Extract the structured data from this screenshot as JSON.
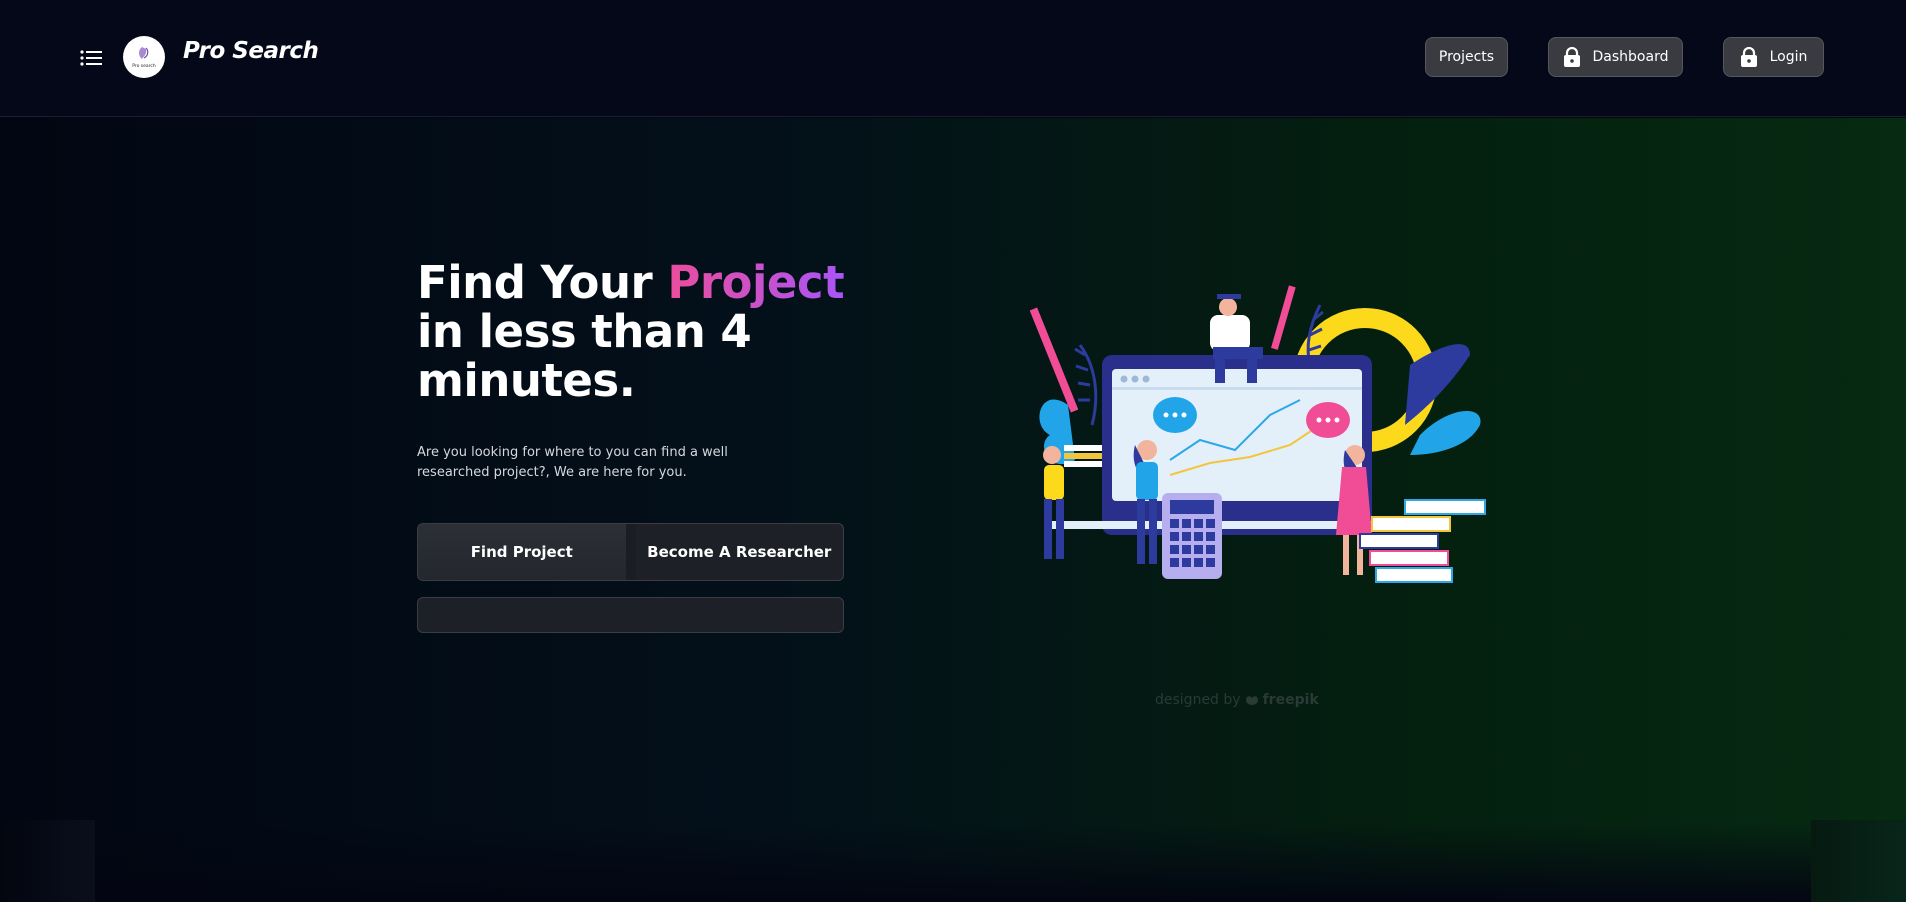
{
  "header": {
    "brand": "Pro Search",
    "logo_text": "Pro search",
    "nav": [
      {
        "label": "Projects",
        "icon": ""
      },
      {
        "label": "Dashboard",
        "icon": "lock-icon"
      },
      {
        "label": "Login",
        "icon": "lock-icon"
      }
    ]
  },
  "hero": {
    "headline_part1": "Find Your ",
    "headline_accent": "Project",
    "headline_line2": "in less than 4",
    "headline_line3": "minutes.",
    "subtext": "Are you looking for where to you can find a well researched project?, We are here for you.",
    "tabs": [
      {
        "label": "Find Project",
        "active": true
      },
      {
        "label": "Become A Researcher",
        "active": false
      }
    ],
    "search_value": ""
  },
  "illustration": {
    "icon": "education-illustration",
    "credit_prefix": "designed by",
    "credit_brand": "freepik"
  },
  "colors": {
    "accent_start": "#ec4d9c",
    "accent_end": "#a855f7",
    "nav_button": "#3a3b40"
  }
}
